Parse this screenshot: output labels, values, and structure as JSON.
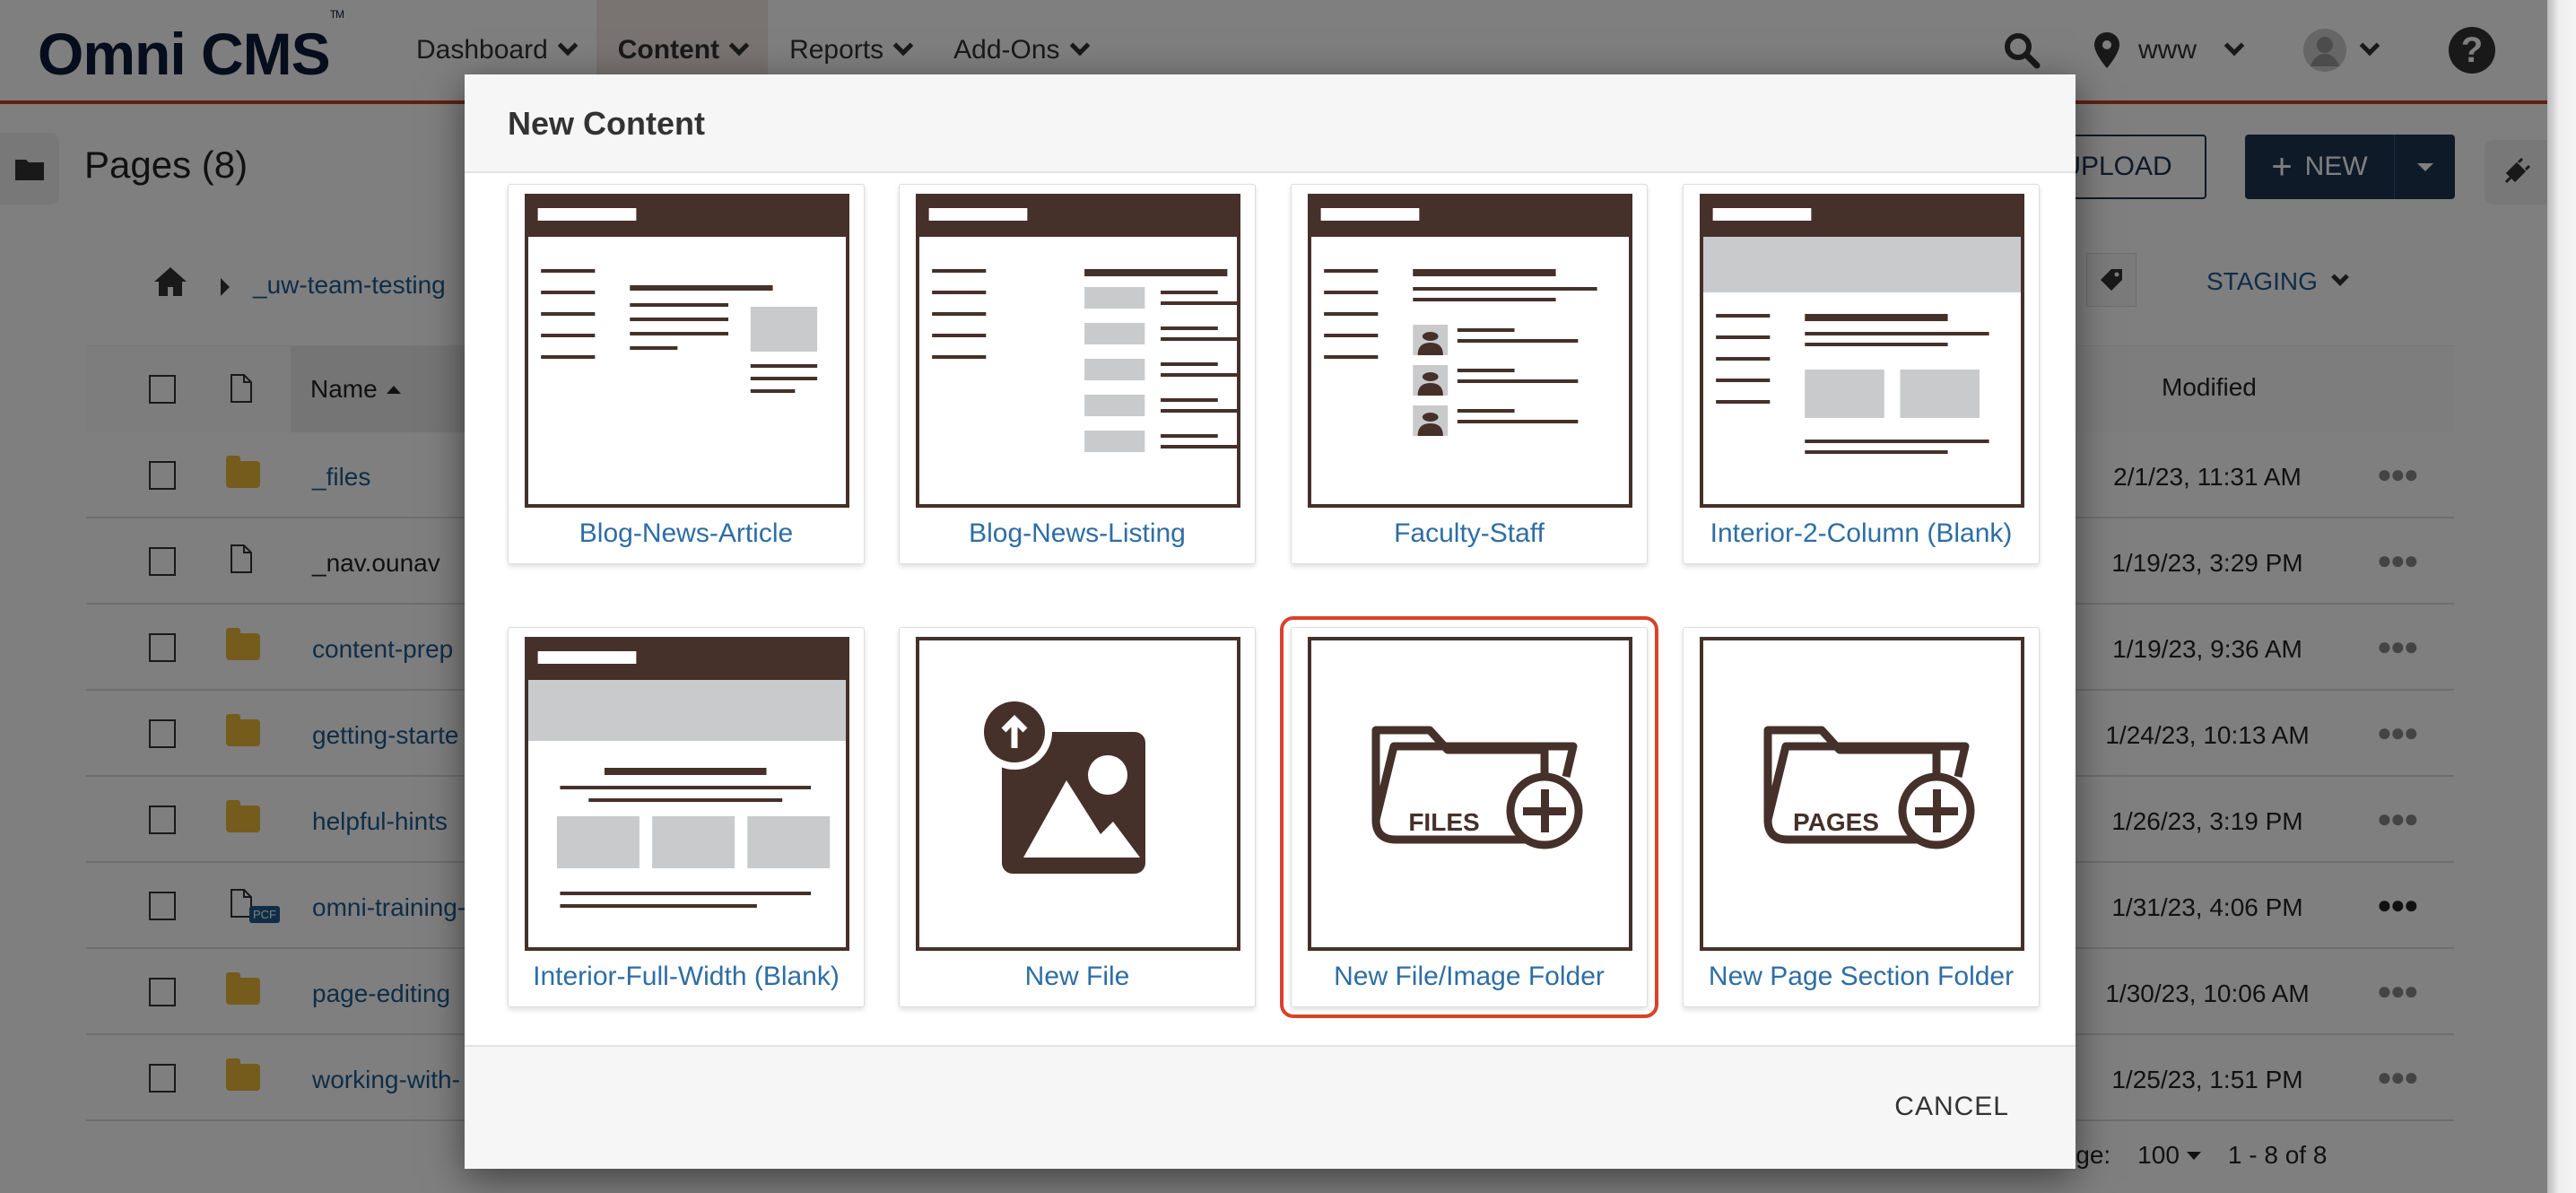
{
  "app": {
    "brand": "Omni CMS",
    "trademark": "TM",
    "nav": [
      {
        "label": "Dashboard",
        "active": false
      },
      {
        "label": "Content",
        "active": true
      },
      {
        "label": "Reports",
        "active": false
      },
      {
        "label": "Add-Ons",
        "active": false
      }
    ],
    "site_selector": "www",
    "accent_color": "#c4421f",
    "brand_color": "#0d1b38"
  },
  "page": {
    "title": "Pages (8)",
    "upload_label": "UPLOAD",
    "new_label": "NEW",
    "breadcrumb": [
      "_uw-team-testing"
    ],
    "environment": "STAGING",
    "columns": {
      "name": "Name",
      "modified": "Modified"
    },
    "rows": [
      {
        "name": "_files",
        "type": "folder",
        "modified": "2/1/23, 11:31 AM"
      },
      {
        "name": "_nav.ounav",
        "type": "file",
        "modified": "1/19/23, 3:29 PM"
      },
      {
        "name": "content-prep",
        "type": "folder",
        "modified": "1/19/23, 9:36 AM"
      },
      {
        "name": "getting-starte",
        "type": "folder",
        "modified": "1/24/23, 10:13 AM"
      },
      {
        "name": "helpful-hints",
        "type": "folder",
        "modified": "1/26/23, 3:19 PM"
      },
      {
        "name": "omni-training-",
        "type": "pcf",
        "badge": "PCF",
        "modified": "1/31/23, 4:06 PM"
      },
      {
        "name": "page-editing",
        "type": "folder",
        "modified": "1/30/23, 10:06 AM"
      },
      {
        "name": "working-with-",
        "type": "folder",
        "modified": "1/25/23, 1:51 PM"
      }
    ],
    "pagination": {
      "per_page_label": "r page:",
      "per_page_value": "100",
      "range": "1 - 8 of 8"
    }
  },
  "modal": {
    "title": "New Content",
    "cancel_label": "CANCEL",
    "templates": [
      {
        "label": "Blog-News-Article",
        "thumb": "article"
      },
      {
        "label": "Blog-News-Listing",
        "thumb": "listing"
      },
      {
        "label": "Faculty-Staff",
        "thumb": "faculty"
      },
      {
        "label": "Interior-2-Column (Blank)",
        "thumb": "two-col"
      },
      {
        "label": "Interior-Full-Width (Blank)",
        "thumb": "full-width"
      },
      {
        "label": "New File",
        "thumb": "new-file"
      },
      {
        "label": "New File/Image Folder",
        "thumb": "files-folder",
        "folder_text": "FILES",
        "highlighted": true
      },
      {
        "label": "New Page Section Folder",
        "thumb": "pages-folder",
        "folder_text": "PAGES"
      }
    ],
    "highlight_color": "#d9412b",
    "template_color": "#45302a"
  }
}
